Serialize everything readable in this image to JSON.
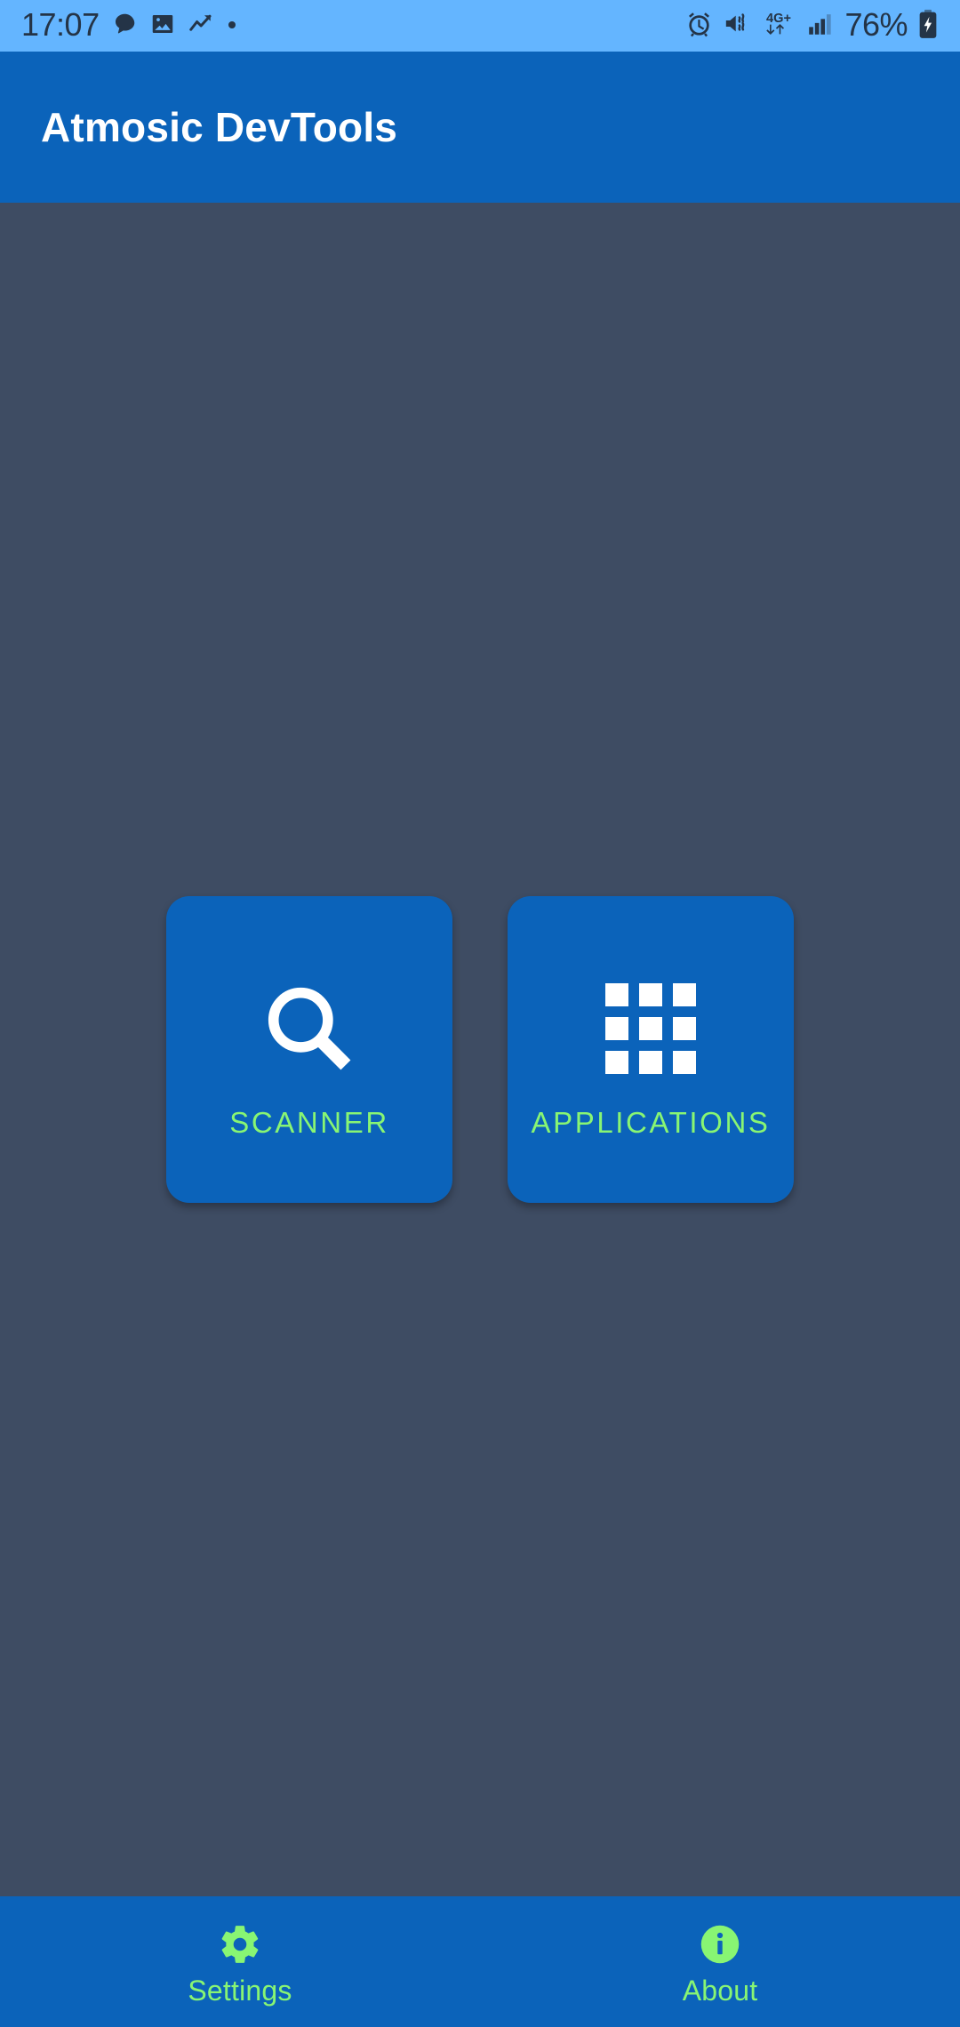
{
  "status_bar": {
    "clock": "17:07",
    "battery_percent": "76%",
    "network_type": "4G+",
    "left_icons": [
      "chat-bubble-icon",
      "photo-icon",
      "trending-up-icon",
      "dot-icon"
    ],
    "right_icons": [
      "alarm-icon",
      "vibrate-mute-icon",
      "mobile-data-icon",
      "signal-bars-icon",
      "battery-charging-icon"
    ],
    "background_color": "#64B5FF",
    "foreground_color": "#243447"
  },
  "app_bar": {
    "title": "Atmosic DevTools",
    "background_color": "#0B63BA",
    "title_color": "#FFFFFF"
  },
  "main": {
    "background_color": "#3E4C63",
    "tiles": [
      {
        "label": "SCANNER",
        "icon": "magnifier-icon"
      },
      {
        "label": "APPLICATIONS",
        "icon": "grid-apps-icon"
      }
    ],
    "tile_background_color": "#0B63BA",
    "tile_label_color": "#88F573",
    "tile_icon_color": "#FFFFFF"
  },
  "bottom_nav": {
    "background_color": "#0B63BA",
    "item_color": "#88F573",
    "items": [
      {
        "label": "Settings",
        "icon": "gear-icon"
      },
      {
        "label": "About",
        "icon": "info-circle-icon"
      }
    ]
  }
}
